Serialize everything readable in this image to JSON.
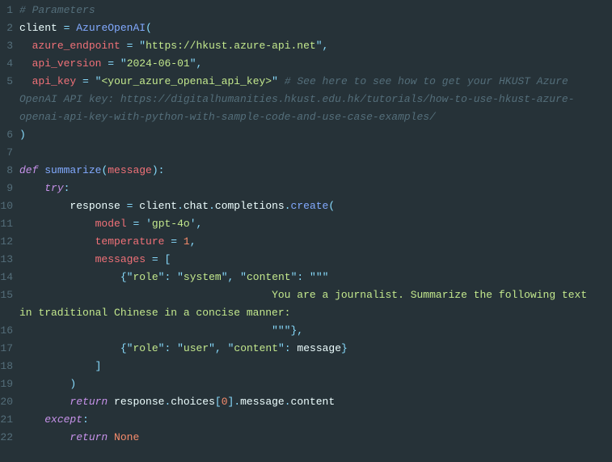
{
  "lines": [
    {
      "n": "1",
      "tokens": [
        {
          "cls": "c-comment",
          "t": "# Parameters"
        }
      ]
    },
    {
      "n": "2",
      "tokens": [
        {
          "cls": "c-white",
          "t": "client "
        },
        {
          "cls": "c-op",
          "t": "="
        },
        {
          "cls": "c-white",
          "t": " "
        },
        {
          "cls": "c-call",
          "t": "AzureOpenAI"
        },
        {
          "cls": "c-punct",
          "t": "("
        }
      ]
    },
    {
      "n": "3",
      "tokens": [
        {
          "cls": "c-white",
          "t": "  "
        },
        {
          "cls": "c-param",
          "t": "azure_endpoint"
        },
        {
          "cls": "c-white",
          "t": " "
        },
        {
          "cls": "c-op",
          "t": "="
        },
        {
          "cls": "c-white",
          "t": " "
        },
        {
          "cls": "c-punct",
          "t": "\""
        },
        {
          "cls": "c-string",
          "t": "https://hkust.azure-api.net"
        },
        {
          "cls": "c-punct",
          "t": "\""
        },
        {
          "cls": "c-punct",
          "t": ","
        }
      ]
    },
    {
      "n": "4",
      "tokens": [
        {
          "cls": "c-white",
          "t": "  "
        },
        {
          "cls": "c-param",
          "t": "api_version"
        },
        {
          "cls": "c-white",
          "t": " "
        },
        {
          "cls": "c-op",
          "t": "="
        },
        {
          "cls": "c-white",
          "t": " "
        },
        {
          "cls": "c-punct",
          "t": "\""
        },
        {
          "cls": "c-string",
          "t": "2024-06-01"
        },
        {
          "cls": "c-punct",
          "t": "\""
        },
        {
          "cls": "c-punct",
          "t": ","
        }
      ]
    },
    {
      "n": "5",
      "tokens": [
        {
          "cls": "c-white",
          "t": "  "
        },
        {
          "cls": "c-param",
          "t": "api_key"
        },
        {
          "cls": "c-white",
          "t": " "
        },
        {
          "cls": "c-op",
          "t": "="
        },
        {
          "cls": "c-white",
          "t": " "
        },
        {
          "cls": "c-punct",
          "t": "\""
        },
        {
          "cls": "c-string",
          "t": "<your_azure_openai_api_key>"
        },
        {
          "cls": "c-punct",
          "t": "\""
        },
        {
          "cls": "c-white",
          "t": " "
        },
        {
          "cls": "c-comment",
          "t": "# See here to see how to get your HKUST Azure OpenAI API key: https://digitalhumanities.hkust.edu.hk/tutorials/how-to-use-hkust-azure-openai-api-key-with-python-with-sample-code-and-use-case-examples/"
        }
      ]
    },
    {
      "n": "6",
      "tokens": [
        {
          "cls": "c-punct",
          "t": ")"
        }
      ]
    },
    {
      "n": "7",
      "tokens": [
        {
          "cls": "c-white",
          "t": ""
        }
      ]
    },
    {
      "n": "8",
      "tokens": [
        {
          "cls": "c-keyword",
          "t": "def"
        },
        {
          "cls": "c-white",
          "t": " "
        },
        {
          "cls": "c-func",
          "t": "summarize"
        },
        {
          "cls": "c-punct",
          "t": "("
        },
        {
          "cls": "c-param",
          "t": "message"
        },
        {
          "cls": "c-punct",
          "t": "):"
        }
      ]
    },
    {
      "n": "9",
      "tokens": [
        {
          "cls": "c-white",
          "t": "    "
        },
        {
          "cls": "c-keyword",
          "t": "try"
        },
        {
          "cls": "c-punct",
          "t": ":"
        }
      ]
    },
    {
      "n": "10",
      "tokens": [
        {
          "cls": "c-white",
          "t": "        response "
        },
        {
          "cls": "c-op",
          "t": "="
        },
        {
          "cls": "c-white",
          "t": " client"
        },
        {
          "cls": "c-punct",
          "t": "."
        },
        {
          "cls": "c-white",
          "t": "chat"
        },
        {
          "cls": "c-punct",
          "t": "."
        },
        {
          "cls": "c-white",
          "t": "completions"
        },
        {
          "cls": "c-punct",
          "t": "."
        },
        {
          "cls": "c-call",
          "t": "create"
        },
        {
          "cls": "c-punct",
          "t": "("
        }
      ]
    },
    {
      "n": "11",
      "tokens": [
        {
          "cls": "c-white",
          "t": "            "
        },
        {
          "cls": "c-param",
          "t": "model"
        },
        {
          "cls": "c-white",
          "t": " "
        },
        {
          "cls": "c-op",
          "t": "="
        },
        {
          "cls": "c-white",
          "t": " "
        },
        {
          "cls": "c-punct",
          "t": "'"
        },
        {
          "cls": "c-string",
          "t": "gpt-4o"
        },
        {
          "cls": "c-punct",
          "t": "'"
        },
        {
          "cls": "c-punct",
          "t": ","
        }
      ]
    },
    {
      "n": "12",
      "tokens": [
        {
          "cls": "c-white",
          "t": "            "
        },
        {
          "cls": "c-param",
          "t": "temperature"
        },
        {
          "cls": "c-white",
          "t": " "
        },
        {
          "cls": "c-op",
          "t": "="
        },
        {
          "cls": "c-white",
          "t": " "
        },
        {
          "cls": "c-num",
          "t": "1"
        },
        {
          "cls": "c-punct",
          "t": ","
        }
      ]
    },
    {
      "n": "13",
      "tokens": [
        {
          "cls": "c-white",
          "t": "            "
        },
        {
          "cls": "c-param",
          "t": "messages"
        },
        {
          "cls": "c-white",
          "t": " "
        },
        {
          "cls": "c-op",
          "t": "="
        },
        {
          "cls": "c-white",
          "t": " "
        },
        {
          "cls": "c-punct",
          "t": "["
        }
      ]
    },
    {
      "n": "14",
      "tokens": [
        {
          "cls": "c-white",
          "t": "                "
        },
        {
          "cls": "c-punct",
          "t": "{"
        },
        {
          "cls": "c-punct",
          "t": "\""
        },
        {
          "cls": "c-string",
          "t": "role"
        },
        {
          "cls": "c-punct",
          "t": "\""
        },
        {
          "cls": "c-punct",
          "t": ":"
        },
        {
          "cls": "c-white",
          "t": " "
        },
        {
          "cls": "c-punct",
          "t": "\""
        },
        {
          "cls": "c-string",
          "t": "system"
        },
        {
          "cls": "c-punct",
          "t": "\""
        },
        {
          "cls": "c-punct",
          "t": ","
        },
        {
          "cls": "c-white",
          "t": " "
        },
        {
          "cls": "c-punct",
          "t": "\""
        },
        {
          "cls": "c-string",
          "t": "content"
        },
        {
          "cls": "c-punct",
          "t": "\""
        },
        {
          "cls": "c-punct",
          "t": ":"
        },
        {
          "cls": "c-white",
          "t": " "
        },
        {
          "cls": "c-punct",
          "t": "\"\"\""
        }
      ]
    },
    {
      "n": "15",
      "tokens": [
        {
          "cls": "c-string",
          "t": "                                        You are a journalist. Summarize the following text in traditional Chinese in a concise manner:"
        }
      ]
    },
    {
      "n": "16",
      "tokens": [
        {
          "cls": "c-string",
          "t": "                                        "
        },
        {
          "cls": "c-punct",
          "t": "\"\"\""
        },
        {
          "cls": "c-punct",
          "t": "},"
        }
      ]
    },
    {
      "n": "17",
      "tokens": [
        {
          "cls": "c-white",
          "t": "                "
        },
        {
          "cls": "c-punct",
          "t": "{"
        },
        {
          "cls": "c-punct",
          "t": "\""
        },
        {
          "cls": "c-string",
          "t": "role"
        },
        {
          "cls": "c-punct",
          "t": "\""
        },
        {
          "cls": "c-punct",
          "t": ":"
        },
        {
          "cls": "c-white",
          "t": " "
        },
        {
          "cls": "c-punct",
          "t": "\""
        },
        {
          "cls": "c-string",
          "t": "user"
        },
        {
          "cls": "c-punct",
          "t": "\""
        },
        {
          "cls": "c-punct",
          "t": ","
        },
        {
          "cls": "c-white",
          "t": " "
        },
        {
          "cls": "c-punct",
          "t": "\""
        },
        {
          "cls": "c-string",
          "t": "content"
        },
        {
          "cls": "c-punct",
          "t": "\""
        },
        {
          "cls": "c-punct",
          "t": ":"
        },
        {
          "cls": "c-white",
          "t": " message"
        },
        {
          "cls": "c-punct",
          "t": "}"
        }
      ]
    },
    {
      "n": "18",
      "tokens": [
        {
          "cls": "c-white",
          "t": "            "
        },
        {
          "cls": "c-punct",
          "t": "]"
        }
      ]
    },
    {
      "n": "19",
      "tokens": [
        {
          "cls": "c-white",
          "t": "        "
        },
        {
          "cls": "c-punct",
          "t": ")"
        }
      ]
    },
    {
      "n": "20",
      "tokens": [
        {
          "cls": "c-white",
          "t": "        "
        },
        {
          "cls": "c-keyword",
          "t": "return"
        },
        {
          "cls": "c-white",
          "t": " response"
        },
        {
          "cls": "c-punct",
          "t": "."
        },
        {
          "cls": "c-white",
          "t": "choices"
        },
        {
          "cls": "c-punct",
          "t": "["
        },
        {
          "cls": "c-num",
          "t": "0"
        },
        {
          "cls": "c-punct",
          "t": "]"
        },
        {
          "cls": "c-punct",
          "t": "."
        },
        {
          "cls": "c-white",
          "t": "message"
        },
        {
          "cls": "c-punct",
          "t": "."
        },
        {
          "cls": "c-white",
          "t": "content"
        }
      ]
    },
    {
      "n": "21",
      "tokens": [
        {
          "cls": "c-white",
          "t": "    "
        },
        {
          "cls": "c-keyword",
          "t": "except"
        },
        {
          "cls": "c-punct",
          "t": ":"
        }
      ]
    },
    {
      "n": "22",
      "tokens": [
        {
          "cls": "c-white",
          "t": "        "
        },
        {
          "cls": "c-keyword",
          "t": "return"
        },
        {
          "cls": "c-white",
          "t": " "
        },
        {
          "cls": "c-const",
          "t": "None"
        }
      ]
    }
  ]
}
